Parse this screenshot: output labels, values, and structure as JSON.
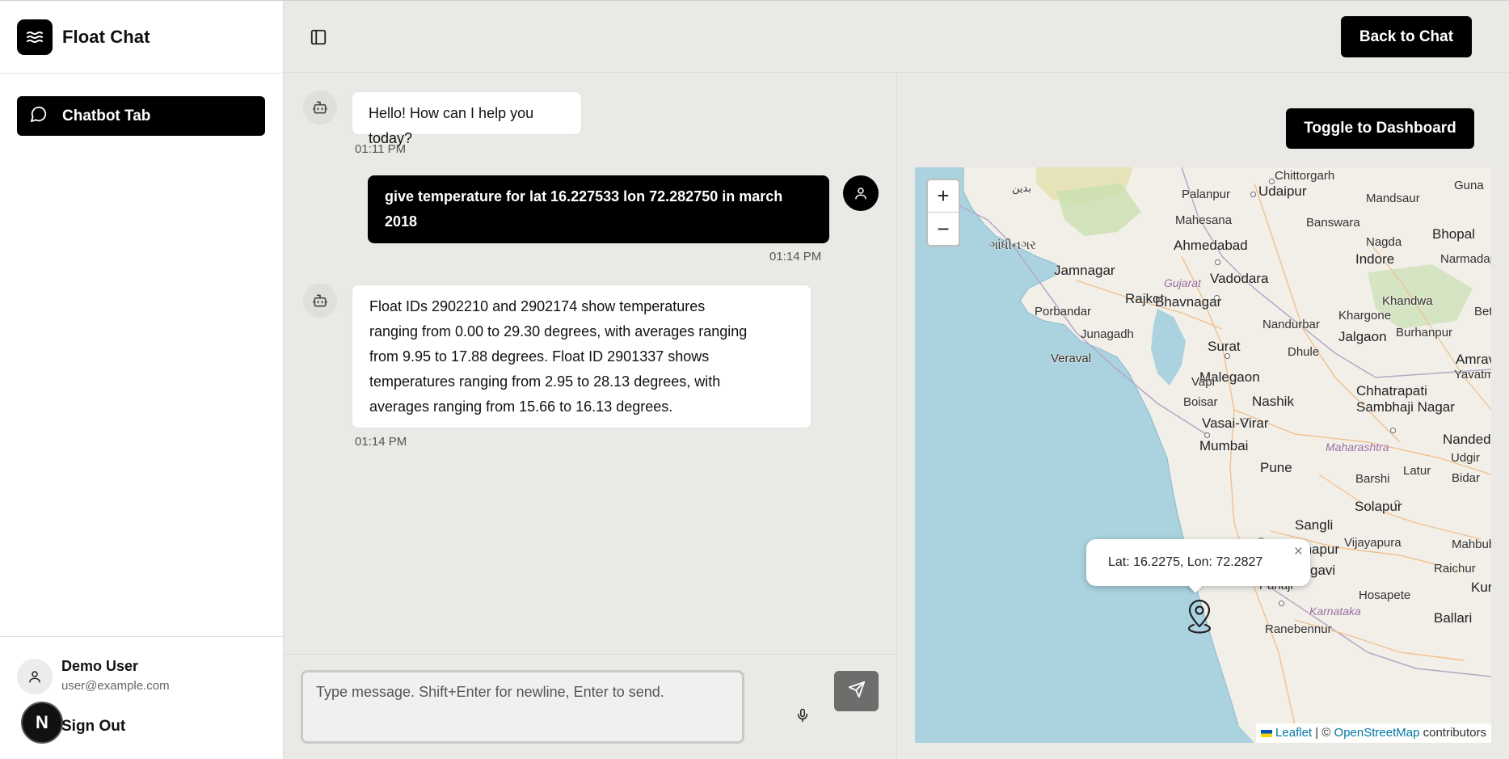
{
  "app": {
    "title": "Float Chat"
  },
  "sidebar": {
    "items": [
      {
        "label": "Chatbot Tab",
        "icon": "message-circle-icon"
      }
    ],
    "user": {
      "name": "Demo User",
      "email": "user@example.com"
    },
    "sign_out_label": "Sign Out",
    "badge_letter": "N"
  },
  "header": {
    "back_label": "Back to Chat"
  },
  "chat": {
    "messages": [
      {
        "role": "bot",
        "text": "Hello! How can I help you today?",
        "time": "01:11 PM"
      },
      {
        "role": "user",
        "lines": [
          "give temperature for lat 16.227533 lon 72.282750 in march",
          "2018"
        ],
        "time": "01:14 PM"
      },
      {
        "role": "bot",
        "lines": [
          "Float IDs 2902210 and 2902174 show temperatures",
          "ranging from 0.00 to 29.30 degrees, with averages ranging",
          "from 9.95 to 17.88 degrees. Float ID 2901337 shows",
          "temperatures ranging from 2.95 to 28.13 degrees, with",
          "averages ranging from 15.66 to 16.13 degrees."
        ],
        "time": "01:14 PM"
      }
    ],
    "input": {
      "value": "",
      "placeholder": "Type message. Shift+Enter for newline, Enter to send."
    }
  },
  "right_panel": {
    "toggle_label": "Toggle to Dashboard",
    "map": {
      "zoom_in": "+",
      "zoom_out": "−",
      "popup_text": "Lat: 16.2275, Lon: 72.2827",
      "popup_close": "×",
      "attribution": {
        "leaflet": "Leaflet",
        "separator": " | © ",
        "osm": "OpenStreetMap",
        "suffix": " contributors"
      },
      "places": [
        "Chittorgarh",
        "Udaipur",
        "Guna",
        "Palanpur",
        "Mandsaur",
        "Mahesana",
        "Banswara",
        "Bhopal",
        "Ahmedabad",
        "Nagda",
        "Indore",
        "Narmadapu",
        "Jamnagar",
        "Vadodara",
        "Gujarat",
        "Rajkot",
        "Bhavnagar",
        "Khandwa",
        "Porbandar",
        "Khargone",
        "Betu",
        "Junagadh",
        "Nandurbar",
        "Burhanpur",
        "Jalgaon",
        "Veraval",
        "Surat",
        "Dhule",
        "Amrava",
        "Yavatmal",
        "Malegaon",
        "Vapi",
        "Chhatrapati",
        "Sambhaji Nagar",
        "Boisar",
        "Nashik",
        "Vasai-Virar",
        "Mumbai",
        "Maharashtra",
        "Nanded",
        "Udgir",
        "Pune",
        "Latur",
        "Bidar",
        "Barshi",
        "Solapur",
        "Sangli",
        "Kolhapur",
        "Vijayapura",
        "Mahbub",
        "Belagavi",
        "Raichur",
        "Panaji",
        "Hosapete",
        "Kurr",
        "Karnataka",
        "Ballari",
        "Ranebennur",
        "ગાંધીનગર",
        "بدين"
      ]
    }
  }
}
